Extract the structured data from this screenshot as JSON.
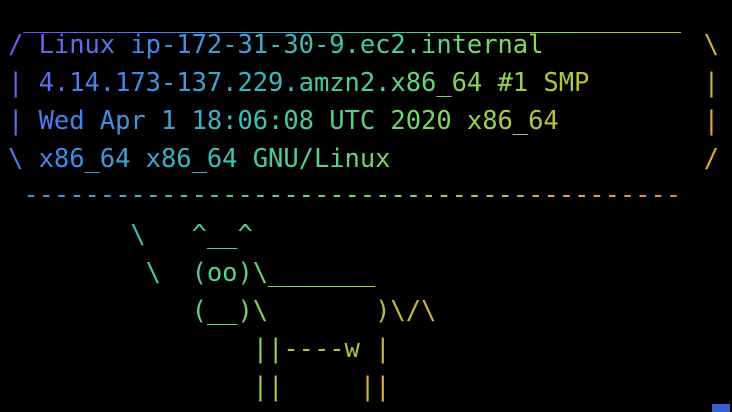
{
  "terminal": {
    "lines": [
      " ___________________________________________",
      "/ Linux ip-172-31-30-9.ec2.internal       \\",
      "| 4.14.173-137.229.amzn2.x86_64 #1 SMP |",
      "| Wed Apr 1 18:06:08 UTC 2020 x86_64   |",
      "\\ x86_64 x86_64 GNU/Linux              /",
      " -------------------------------------------",
      "        \\   ^__^",
      "         \\  (oo)\\_______",
      "            (__)\\       )\\/\\",
      "                ||----w |",
      "                ||     ||"
    ],
    "colors": {
      "start": "#7b4ef5",
      "mid1": "#3f8ae8",
      "mid2": "#3ec9a8",
      "mid3": "#8bd94e",
      "end": "#f0a030",
      "end2": "#e86a3a"
    }
  }
}
